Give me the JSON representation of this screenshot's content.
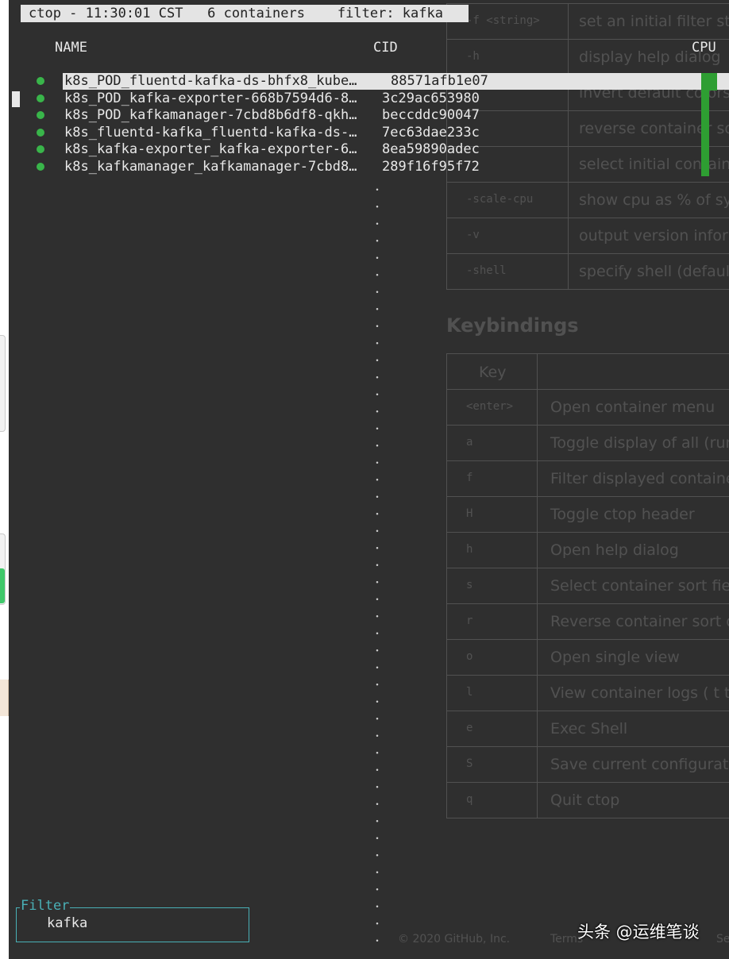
{
  "header": {
    "text": "ctop - 11:30:01 CST   6 containers    filter: kafka"
  },
  "columns": {
    "name": "NAME",
    "cid": "CID",
    "cpu": "CPU"
  },
  "containers": [
    {
      "name": "k8s_POD_fluentd-kafka-ds-bhfx8_kube…",
      "cid": "88571afb1e07",
      "status": "running",
      "selected": true
    },
    {
      "name": "k8s_POD_kafka-exporter-668b7594d6-8…",
      "cid": "3c29ac653980",
      "status": "running",
      "selected": false
    },
    {
      "name": "k8s_POD_kafkamanager-7cbd8b6df8-qkh…",
      "cid": "beccddc90047",
      "status": "running",
      "selected": false
    },
    {
      "name": "k8s_fluentd-kafka_fluentd-kafka-ds-…",
      "cid": "7ec63dae233c",
      "status": "running",
      "selected": false
    },
    {
      "name": "k8s_kafka-exporter_kafka-exporter-6…",
      "cid": "8ea59890adec",
      "status": "running",
      "selected": false
    },
    {
      "name": "k8s_kafkamanager_kafkamanager-7cbd8…",
      "cid": "289f16f95f72",
      "status": "running",
      "selected": false
    }
  ],
  "filter": {
    "label": "Filter",
    "value": "kafka"
  },
  "background_page": {
    "options": [
      {
        "flag": "-f <string>",
        "desc": "set an initial filter stri"
      },
      {
        "flag": "-h",
        "desc": "display help dialog"
      },
      {
        "flag": "",
        "desc": "invert default colors"
      },
      {
        "flag": "",
        "desc": "reverse container sort"
      },
      {
        "flag": "",
        "desc": "select initial container"
      },
      {
        "flag": "-scale-cpu",
        "desc": "show cpu as % of syst"
      },
      {
        "flag": "-v",
        "desc": "output version inform"
      },
      {
        "flag": "-shell",
        "desc": "specify shell (default:"
      }
    ],
    "keybindings_title": "Keybindings",
    "key_header": "Key",
    "keybindings": [
      {
        "key": "<enter>",
        "desc": "Open container menu"
      },
      {
        "key": "a",
        "desc": "Toggle display of all (runn"
      },
      {
        "key": "f",
        "desc": "Filter displayed containers"
      },
      {
        "key": "H",
        "desc": "Toggle ctop header"
      },
      {
        "key": "h",
        "desc": "Open help dialog"
      },
      {
        "key": "s",
        "desc": "Select container sort field"
      },
      {
        "key": "r",
        "desc": "Reverse container sort ord"
      },
      {
        "key": "o",
        "desc": "Open single view"
      },
      {
        "key": "l",
        "desc": "View container logs ( t  to"
      },
      {
        "key": "e",
        "desc": "Exec Shell"
      },
      {
        "key": "S",
        "desc": "Save current configuration"
      },
      {
        "key": "q",
        "desc": "Quit ctop"
      }
    ],
    "footer": "© 2020 GitHub, Inc.",
    "footer_terms": "Terms",
    "footer_more": "Se"
  },
  "watermark": "头条 @运维笔谈",
  "colors": {
    "terminal_bg": "#2f2f2f",
    "status_running": "#39b54a",
    "cpu_bar": "#2e9e32",
    "filter_border": "#49b0b6",
    "highlight": "#e4e4e4"
  }
}
